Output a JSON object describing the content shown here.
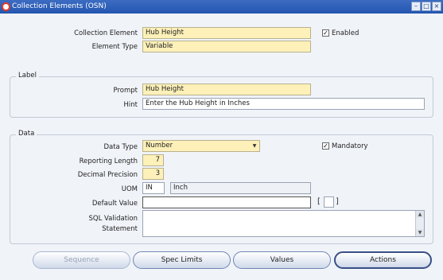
{
  "window": {
    "title": "Collection Elements (OSN)",
    "controls": [
      "minimize",
      "maximize",
      "close"
    ]
  },
  "header": {
    "collection_element_label": "Collection Element",
    "collection_element_value": "Hub Height",
    "element_type_label": "Element Type",
    "element_type_value": "Variable",
    "enabled_label": "Enabled",
    "enabled_checked": true
  },
  "label_group": {
    "title": "Label",
    "prompt_label": "Prompt",
    "prompt_value": "Hub Height",
    "hint_label": "Hint",
    "hint_value": "Enter the Hub Height in Inches"
  },
  "data_group": {
    "title": "Data",
    "data_type_label": "Data Type",
    "data_type_value": "Number",
    "mandatory_label": "Mandatory",
    "mandatory_checked": true,
    "reporting_length_label": "Reporting Length",
    "reporting_length_value": "7",
    "decimal_precision_label": "Decimal Precision",
    "decimal_precision_value": "3",
    "uom_label": "UOM",
    "uom_code": "IN",
    "uom_name": "Inch",
    "default_value_label": "Default Value",
    "default_value": "",
    "sql_validation_label_1": "SQL Validation",
    "sql_validation_label_2": "Statement",
    "sql_validation_value": ""
  },
  "buttons": {
    "sequence": "Sequence",
    "spec_limits": "Spec Limits",
    "values": "Values",
    "actions": "Actions"
  },
  "colors": {
    "titlebar": "#2a5bb5",
    "required_field": "#fdf0b8",
    "background": "#f0f3f8"
  }
}
